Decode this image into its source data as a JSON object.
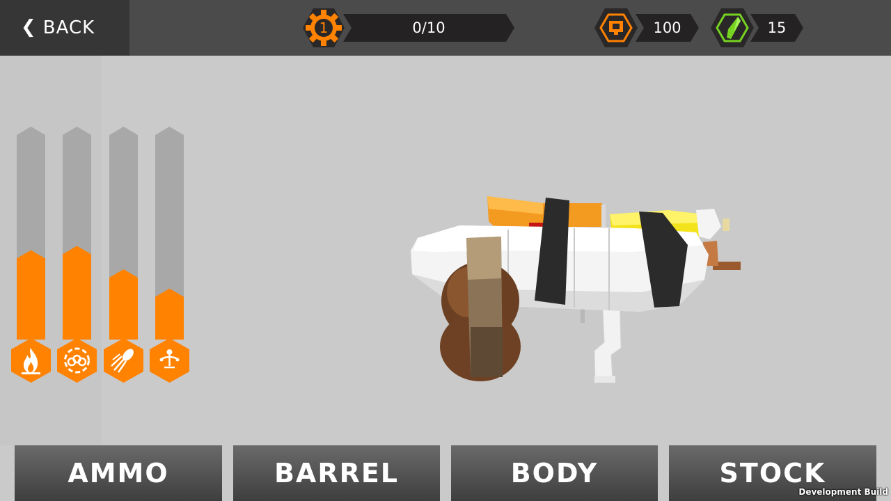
{
  "topbar": {
    "back_label": "BACK",
    "level": "1",
    "progress": "0/10",
    "coins": "100",
    "gems": "15"
  },
  "stats": [
    {
      "name": "fire-damage-icon",
      "fill": 0.42
    },
    {
      "name": "explosion-icon",
      "fill": 0.44
    },
    {
      "name": "projectile-speed-icon",
      "fill": 0.33
    },
    {
      "name": "spread-icon",
      "fill": 0.24
    }
  ],
  "tabs": [
    "AMMO",
    "BARREL",
    "BODY",
    "STOCK"
  ],
  "footer": {
    "dev_build": "Development Build"
  },
  "colors": {
    "accent": "#ff8200",
    "gem": "#76d321",
    "topbar": "#4b4b4b",
    "background": "#cacaca"
  }
}
